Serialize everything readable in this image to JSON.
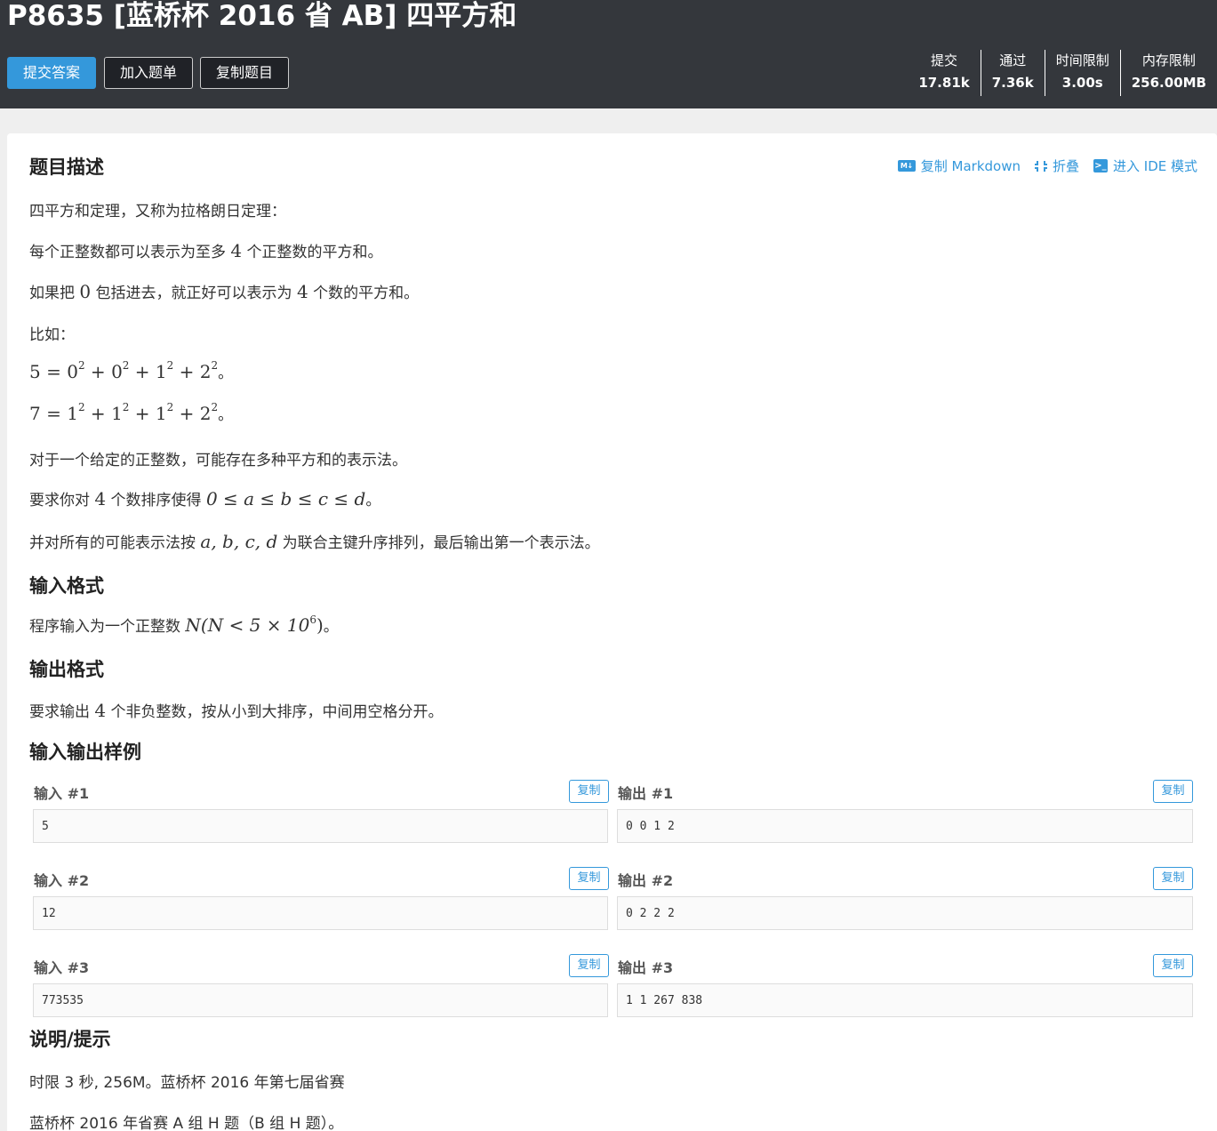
{
  "header": {
    "title": "P8635 [蓝桥杯 2016 省 AB] 四平方和",
    "buttons": {
      "submit": "提交答案",
      "add_to_list": "加入题单",
      "copy_problem": "复制题目"
    },
    "stats": [
      {
        "label": "提交",
        "value": "17.81k"
      },
      {
        "label": "通过",
        "value": "7.36k"
      },
      {
        "label": "时间限制",
        "value": "3.00s"
      },
      {
        "label": "内存限制",
        "value": "256.00MB"
      }
    ]
  },
  "toolbar": {
    "copy_markdown": "复制 Markdown",
    "fold": "折叠",
    "ide_mode": "进入 IDE 模式",
    "md_icon_text": "M↓",
    "term_icon_text": ">_"
  },
  "description": {
    "title": "题目描述",
    "p1": "四平方和定理，又称为拉格朗日定理：",
    "p2_a": "每个正整数都可以表示为至多 ",
    "p2_num": "4",
    "p2_b": " 个正整数的平方和。",
    "p3_a": "如果把 ",
    "p3_zero": "0",
    "p3_b": " 包括进去，就正好可以表示为 ",
    "p3_num": "4",
    "p3_c": " 个数的平方和。",
    "p4": "比如：",
    "eq1": {
      "lhs": "5 = ",
      "t1": "0",
      "t2": "0",
      "t3": "1",
      "t4": "2",
      "exp": "2",
      "plus": " + ",
      "end": "。"
    },
    "eq2": {
      "lhs": "7 = ",
      "t1": "1",
      "t2": "1",
      "t3": "1",
      "t4": "2",
      "exp": "2",
      "plus": " + ",
      "end": "。"
    },
    "p5": "对于一个给定的正整数，可能存在多种平方和的表示法。",
    "p6_a": "要求你对 ",
    "p6_num": "4",
    "p6_b": " 个数排序使得 ",
    "p6_math": "0 ≤ a ≤ b ≤ c ≤ d",
    "p6_end": "。",
    "p7_a": "并对所有的可能表示法按 ",
    "p7_math": "a, b, c, d",
    "p7_b": " 为联合主键升序排列，最后输出第一个表示法。"
  },
  "input_format": {
    "title": "输入格式",
    "text_a": "程序输入为一个正整数 ",
    "math_a": "N(N < 5 × 10",
    "math_exp": "6",
    "math_b": ")",
    "text_end": "。"
  },
  "output_format": {
    "title": "输出格式",
    "text_a": "要求输出 ",
    "num": "4",
    "text_b": " 个非负整数，按从小到大排序，中间用空格分开。"
  },
  "samples": {
    "title": "输入输出样例",
    "copy_label": "复制",
    "items": [
      {
        "in_label": "输入 #1",
        "in": "5",
        "out_label": "输出 #1",
        "out": "0 0 1 2"
      },
      {
        "in_label": "输入 #2",
        "in": "12",
        "out_label": "输出 #2",
        "out": "0 2 2 2"
      },
      {
        "in_label": "输入 #3",
        "in": "773535",
        "out_label": "输出 #3",
        "out": "1 1 267 838"
      }
    ]
  },
  "hint": {
    "title": "说明/提示",
    "p1": "时限 3 秒, 256M。蓝桥杯 2016 年第七届省赛",
    "p2": "蓝桥杯 2016 年省赛 A 组 H 题（B 组 H 题）。"
  },
  "colors": {
    "accent": "#3498db",
    "header_bg": "#34373c"
  }
}
